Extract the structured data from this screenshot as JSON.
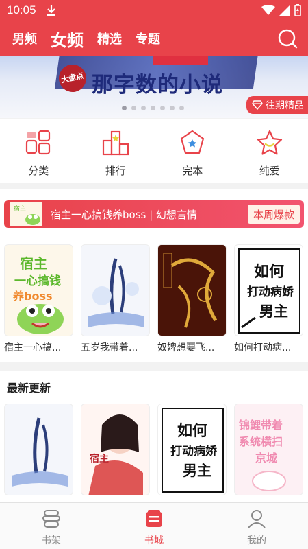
{
  "status_bar": {
    "time": "10:05"
  },
  "header": {
    "tabs": [
      {
        "label": "男频",
        "active": false
      },
      {
        "label": "女频",
        "active": true
      },
      {
        "label": "精选",
        "active": false
      },
      {
        "label": "专题",
        "active": false
      }
    ]
  },
  "banner": {
    "seal_text": "大盘点",
    "headline": "那字数的小说",
    "badge": "往期精品"
  },
  "categories": [
    {
      "label": "分类",
      "icon": "category-icon"
    },
    {
      "label": "排行",
      "icon": "ranking-icon"
    },
    {
      "label": "完本",
      "icon": "completed-icon"
    },
    {
      "label": "纯爱",
      "icon": "star-icon"
    }
  ],
  "hot": {
    "title": "宿主一心搞钱养boss | 幻想言情",
    "tag": "本周爆款",
    "books": [
      {
        "title": "宿主一心搞...",
        "cover_text": "宿主一心搞钱养boss"
      },
      {
        "title": "五岁我带着...",
        "cover_text": ""
      },
      {
        "title": "奴婢想要飞...",
        "cover_text": ""
      },
      {
        "title": "如何打动病...",
        "cover_text": "如何打动病娇男主"
      }
    ]
  },
  "latest": {
    "title": "最新更新",
    "books": [
      {
        "cover_text": ""
      },
      {
        "cover_text": ""
      },
      {
        "cover_text": "如何打动病娇男主"
      },
      {
        "cover_text": "锦鲤带着系统横扫京城"
      }
    ]
  },
  "bottom_nav": [
    {
      "label": "书架",
      "active": false
    },
    {
      "label": "书城",
      "active": true
    },
    {
      "label": "我的",
      "active": false
    }
  ],
  "colors": {
    "brand": "#e8434a",
    "white": "#ffffff"
  }
}
